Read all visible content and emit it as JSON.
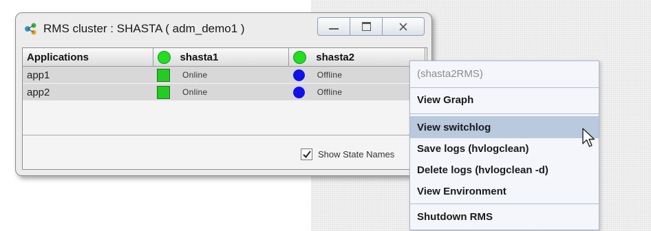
{
  "window": {
    "title": "RMS cluster : SHASTA ( adm_demo1 )",
    "buttons": [
      "minimize",
      "maximize",
      "close"
    ]
  },
  "table": {
    "headers": {
      "applications": "Applications",
      "node1": "shasta1",
      "node2": "shasta2"
    },
    "rows": [
      {
        "app": "app1",
        "node1_status": "Online",
        "node2_status": "Offline"
      },
      {
        "app": "app2",
        "node1_status": "Online",
        "node2_status": "Offline"
      }
    ]
  },
  "footer": {
    "show_state_label": "Show State Names",
    "show_state_checked": true
  },
  "context_menu": {
    "header": "(shasta2RMS)",
    "items": [
      {
        "label": "View Graph"
      },
      {
        "label": "View switchlog",
        "highlighted": true
      },
      {
        "label": "Save logs (hvlogclean)"
      },
      {
        "label": "Delete logs (hvlogclean -d)"
      },
      {
        "label": "View Environment"
      },
      {
        "label": "Shutdown RMS"
      }
    ]
  },
  "colors": {
    "online": "#22cc22",
    "offline": "#1010e8",
    "node_up": "#22dd22",
    "menu_highlight": "#b9c9de"
  },
  "icons": [
    "cluster-icon",
    "minimize-icon",
    "maximize-icon",
    "close-icon",
    "checkbox-check-icon",
    "mouse-pointer-icon"
  ]
}
